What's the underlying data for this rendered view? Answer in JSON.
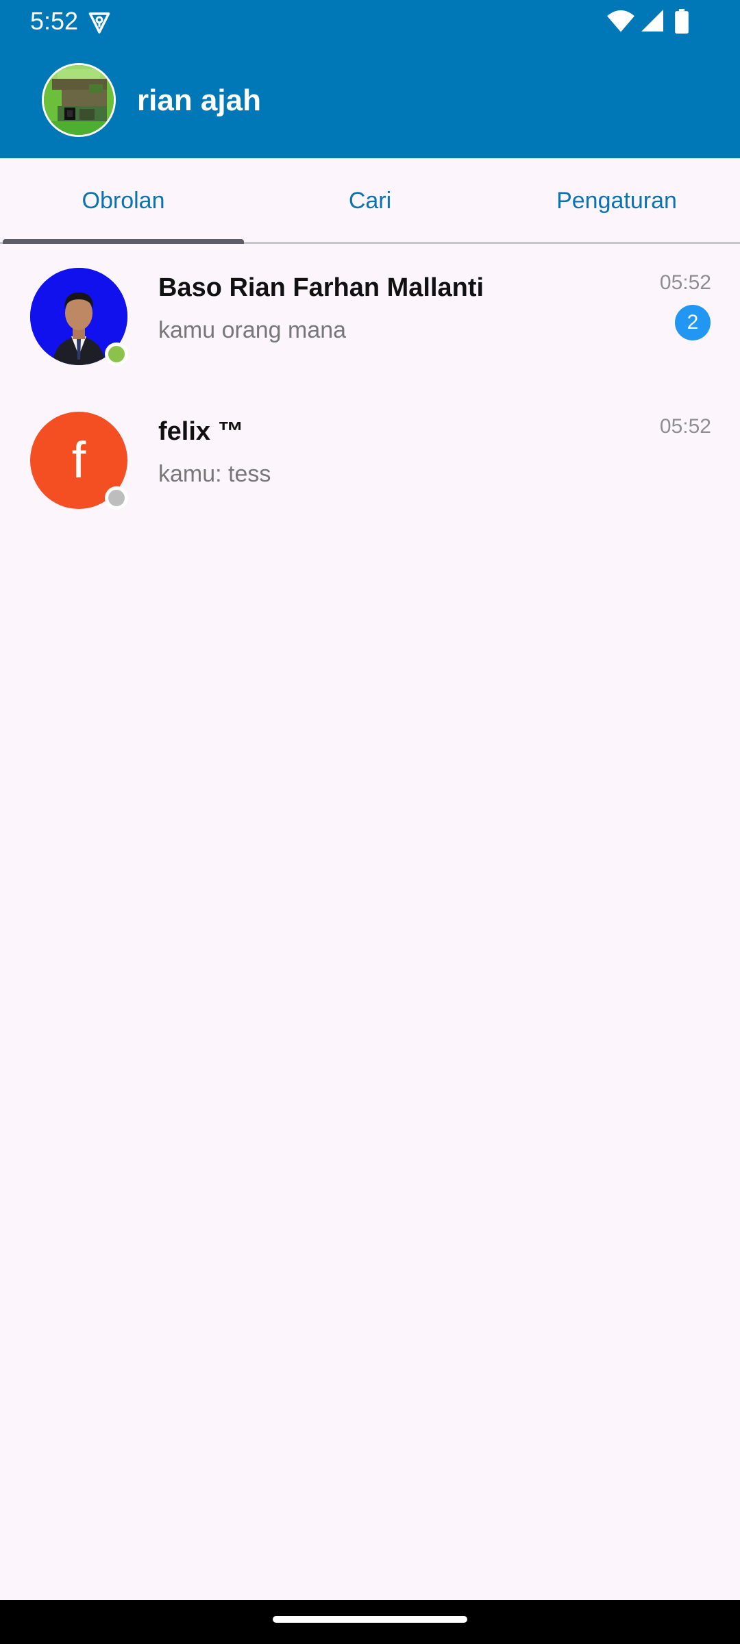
{
  "status_bar": {
    "time": "5:52",
    "icons": [
      "vpn-key-icon",
      "wifi-icon",
      "cellular-signal-icon",
      "battery-icon"
    ]
  },
  "app_bar": {
    "title": "rian ajah",
    "avatar": "pixel-art-avatar"
  },
  "tabs": [
    {
      "label": "Obrolan",
      "selected": true
    },
    {
      "label": "Cari",
      "selected": false
    },
    {
      "label": "Pengaturan",
      "selected": false
    }
  ],
  "chats": [
    {
      "name": "Baso Rian Farhan Mallanti",
      "preview": "kamu orang mana",
      "time": "05:52",
      "unread": "2",
      "online": true,
      "avatar": "photo-avatar"
    },
    {
      "name": "felix ™",
      "preview": "kamu: tess",
      "time": "05:52",
      "online": false,
      "avatar_letter": "f"
    }
  ],
  "colors": {
    "primary": "#0078b8",
    "tab_text": "#0a73b4",
    "background": "#fcf6fc",
    "badge": "#2196f3",
    "online": "#8bc34a",
    "offline": "#bdbdbd",
    "letter_avatar": "#f44f22"
  }
}
